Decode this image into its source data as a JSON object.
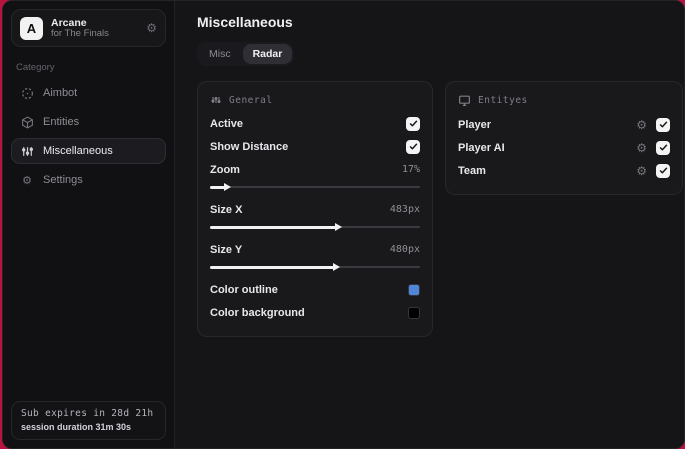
{
  "app": {
    "logo_letter": "A",
    "name": "Arcane",
    "subtitle": "for The Finals"
  },
  "sidebar": {
    "category_label": "Category",
    "items": [
      {
        "label": "Aimbot",
        "icon": "crosshair-icon",
        "active": false
      },
      {
        "label": "Entities",
        "icon": "cube-icon",
        "active": false
      },
      {
        "label": "Miscellaneous",
        "icon": "sliders-icon",
        "active": true
      },
      {
        "label": "Settings",
        "icon": "gear-icon",
        "active": false
      }
    ],
    "footer": {
      "line1": "Sub expires in 28d 21h",
      "line2": "session duration 31m 30s"
    }
  },
  "main": {
    "title": "Miscellaneous",
    "tabs": [
      {
        "label": "Misc",
        "active": false
      },
      {
        "label": "Radar",
        "active": true
      }
    ],
    "general": {
      "title": "General",
      "icon": "sliders-icon",
      "toggles": [
        {
          "label": "Active",
          "checked": true
        },
        {
          "label": "Show Distance",
          "checked": true
        }
      ],
      "sliders": [
        {
          "label": "Zoom",
          "value": "17%",
          "fill": "7%"
        },
        {
          "label": "Size X",
          "value": "483px",
          "fill": "60%"
        },
        {
          "label": "Size Y",
          "value": "480px",
          "fill": "59%"
        }
      ],
      "colors": [
        {
          "label": "Color outline",
          "swatch": "#4f86d8"
        },
        {
          "label": "Color background",
          "swatch": "#000000"
        }
      ]
    },
    "entities": {
      "title": "Entityes",
      "icon": "monitor-icon",
      "rows": [
        {
          "label": "Player",
          "checked": true
        },
        {
          "label": "Player AI",
          "checked": true
        },
        {
          "label": "Team",
          "checked": true
        }
      ]
    }
  },
  "colors": {
    "desktop_background": "#b91440",
    "outline_swatch": "#4f86d8",
    "background_swatch": "#000000"
  },
  "glyphs": {
    "gear": "⚙"
  }
}
